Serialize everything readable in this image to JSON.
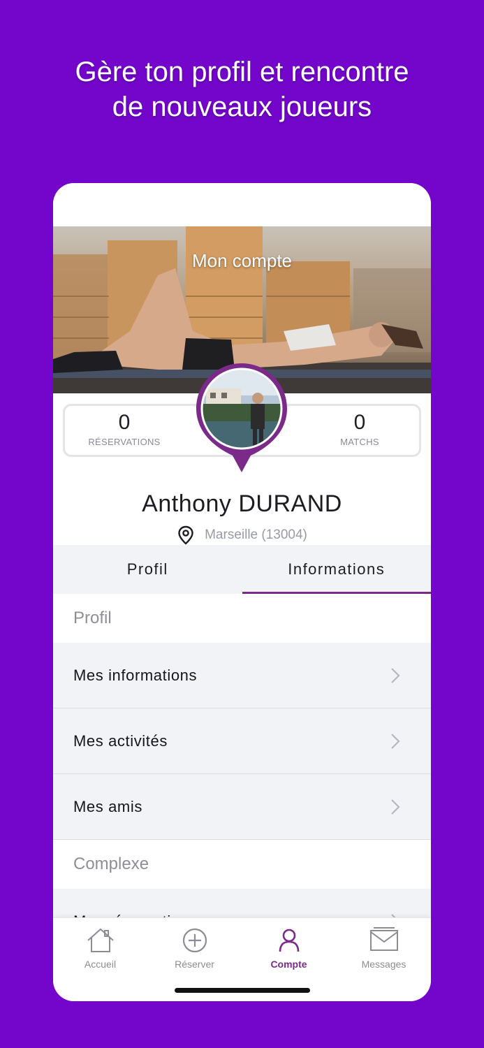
{
  "headline": {
    "line1": "Gère ton profil et rencontre",
    "line2": "de nouveaux joueurs"
  },
  "hero": {
    "title": "Mon compte"
  },
  "stats": {
    "reservations_value": "0",
    "reservations_label": "RÉSERVATIONS",
    "matchs_value": "0",
    "matchs_label": "MATCHS"
  },
  "profile": {
    "first_name": "Anthony",
    "last_name": "DURAND",
    "location": "Marseille (13004)"
  },
  "tabs": [
    {
      "label": "Profil",
      "active": false
    },
    {
      "label": "Informations",
      "active": true
    }
  ],
  "menu": {
    "section1": "Profil",
    "items1": [
      "Mes informations",
      "Mes activités",
      "Mes amis"
    ],
    "section2": "Complexe",
    "items2": [
      "Mes réservations"
    ]
  },
  "tabbar": [
    {
      "label": "Accueil",
      "icon": "home-icon",
      "active": false
    },
    {
      "label": "Réserver",
      "icon": "plus-circle-icon",
      "active": false
    },
    {
      "label": "Compte",
      "icon": "user-icon",
      "active": true
    },
    {
      "label": "Messages",
      "icon": "mail-icon",
      "active": false
    }
  ],
  "colors": {
    "background": "#7406cc",
    "accent": "#7b2a8a",
    "row_bg": "#f2f3f7"
  }
}
